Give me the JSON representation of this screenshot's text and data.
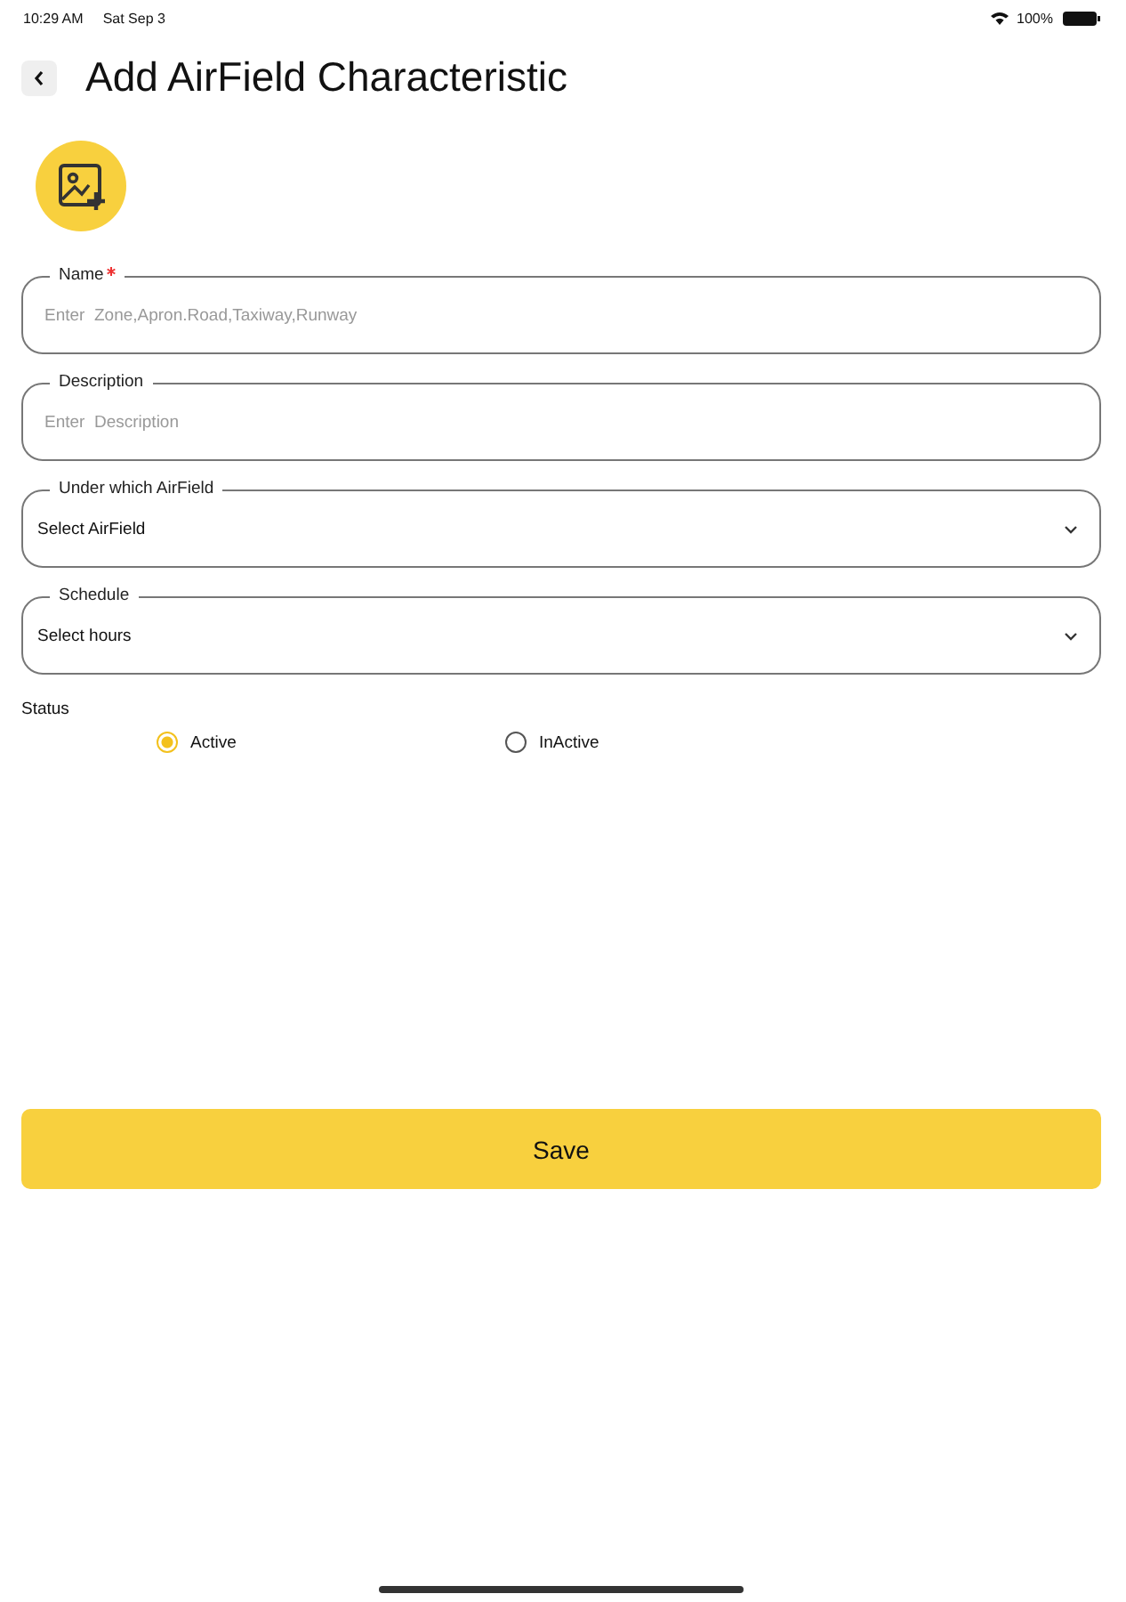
{
  "status_bar": {
    "time": "10:29 AM",
    "date": "Sat Sep 3",
    "battery": "100%"
  },
  "header": {
    "title": "Add AirField Characteristic"
  },
  "fields": [
    {
      "kind": "text",
      "label": "Name",
      "required": true,
      "placeholder": "Enter  Zone,Apron.Road,Taxiway,Runway"
    },
    {
      "kind": "text",
      "label": "Description",
      "required": false,
      "placeholder": "Enter  Description"
    },
    {
      "kind": "select",
      "label": "Under which AirField",
      "required": false,
      "value": "Select AirField"
    },
    {
      "kind": "select",
      "label": "Schedule",
      "required": false,
      "value": "Select hours"
    }
  ],
  "status": {
    "label": "Status",
    "options": [
      {
        "label": "Active",
        "selected": true
      },
      {
        "label": "InActive",
        "selected": false
      }
    ]
  },
  "save_button": "Save"
}
